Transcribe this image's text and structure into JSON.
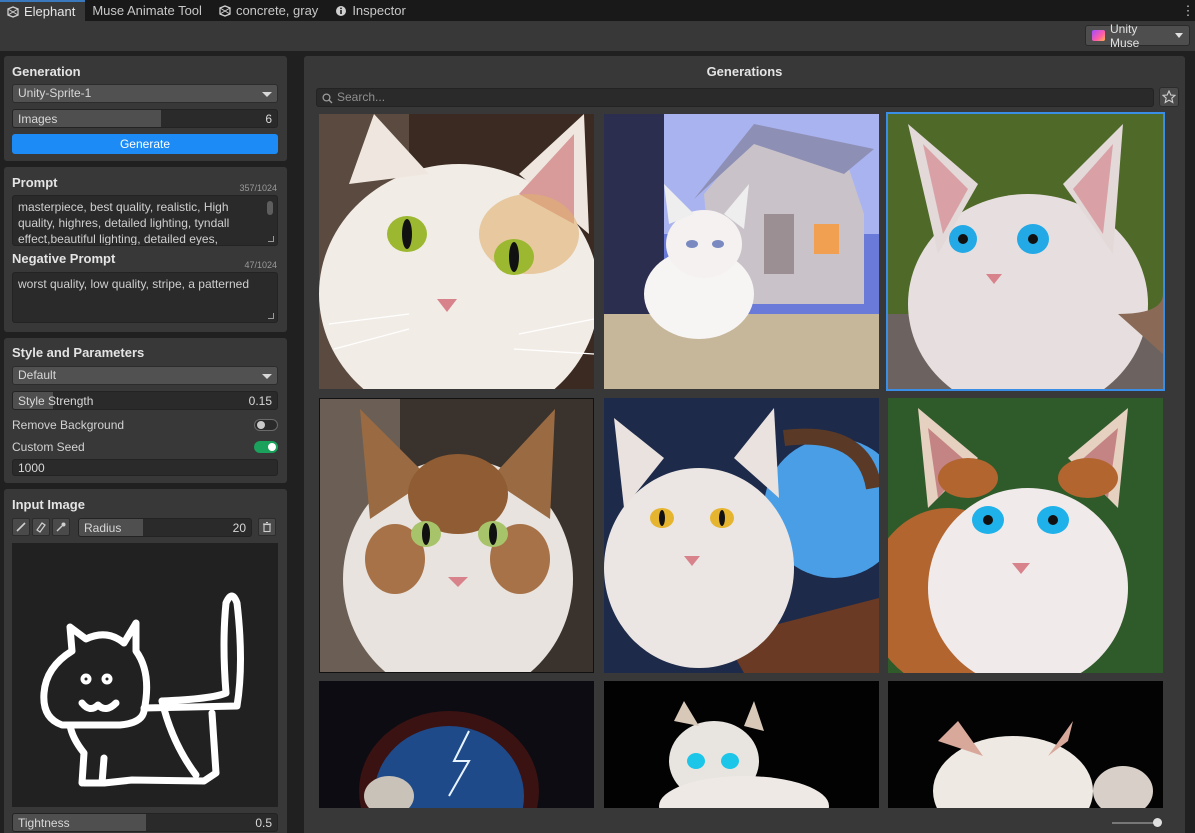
{
  "tabs": [
    {
      "label": "Elephant",
      "icon": "unity-icon"
    },
    {
      "label": "Muse Animate Tool",
      "icon": ""
    },
    {
      "label": "concrete, gray",
      "icon": "unity-icon"
    },
    {
      "label": "Inspector",
      "icon": "info-icon"
    }
  ],
  "toolbar": {
    "muse_label": "Unity Muse"
  },
  "generation": {
    "title": "Generation",
    "model": "Unity-Sprite-1",
    "images_label": "Images",
    "images_value": "6",
    "images_fill": 0.55,
    "generate_label": "Generate"
  },
  "prompt": {
    "title": "Prompt",
    "counter": "357/1024",
    "text": "masterpiece, best quality, realistic, High quality, highres, detailed lighting, tyndall effect,beautiful lighting, detailed eyes,",
    "neg_title": "Negative Prompt",
    "neg_counter": "47/1024",
    "neg_text": "worst quality, low quality, stripe, a patterned"
  },
  "style": {
    "title": "Style and Parameters",
    "style_value": "Default",
    "strength_label": "Style Strength",
    "strength_value": "0.15",
    "strength_fill": 0.15,
    "remove_bg_label": "Remove Background",
    "remove_bg": false,
    "custom_seed_label": "Custom Seed",
    "custom_seed": true,
    "seed_value": "1000"
  },
  "input_image": {
    "title": "Input Image",
    "radius_label": "Radius",
    "radius_value": "20",
    "tightness_label": "Tightness",
    "tightness_value": "0.5",
    "tightness_fill": 0.5
  },
  "gallery": {
    "title": "Generations",
    "search_placeholder": "Search..."
  },
  "colors": {
    "accent": "#1d8bf5",
    "toggle_on": "#1aa15b",
    "selection": "#3a8ee6"
  }
}
